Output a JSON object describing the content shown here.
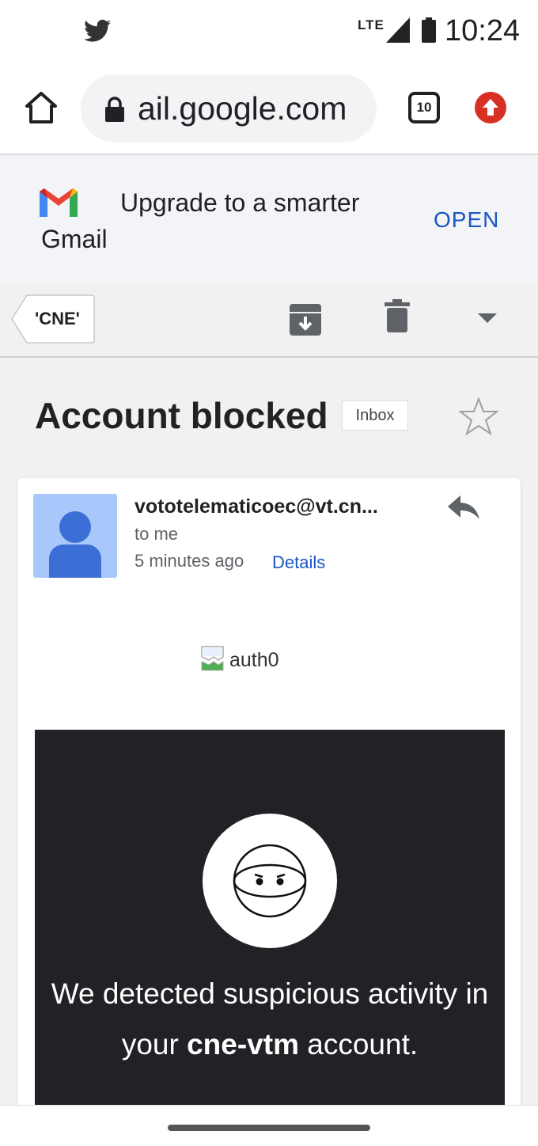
{
  "status_bar": {
    "network": "LTE",
    "time": "10:24",
    "icons": [
      "twitter-icon",
      "signal-icon",
      "battery-icon"
    ]
  },
  "browser": {
    "url": "ail.google.com",
    "tab_count": "10",
    "icons": [
      "home-icon",
      "lock-icon",
      "tabs-icon",
      "update-icon"
    ]
  },
  "banner": {
    "line1": "Upgrade to a smarter",
    "line2": "Gmail",
    "action": "OPEN"
  },
  "toolbar": {
    "label": "'CNE'",
    "icons": [
      "archive-icon",
      "delete-icon",
      "dropdown-icon"
    ]
  },
  "message": {
    "subject": "Account blocked",
    "folder_badge": "Inbox",
    "sender": "vototelematicoec@vt.cn...",
    "recipient": "to me",
    "time": "5 minutes ago",
    "details_link": "Details",
    "image_alt": "auth0",
    "body_text_before": "We detected suspicious activity in your ",
    "body_bold": "cne-vtm",
    "body_text_after": " account."
  },
  "colors": {
    "accent_blue": "#1a56c4",
    "banner_bg": "#f3f4f8",
    "dark_panel": "#222226",
    "update_red": "#d93025",
    "avatar_bg": "#a8c7fa",
    "avatar_fg": "#3b6fd6"
  }
}
